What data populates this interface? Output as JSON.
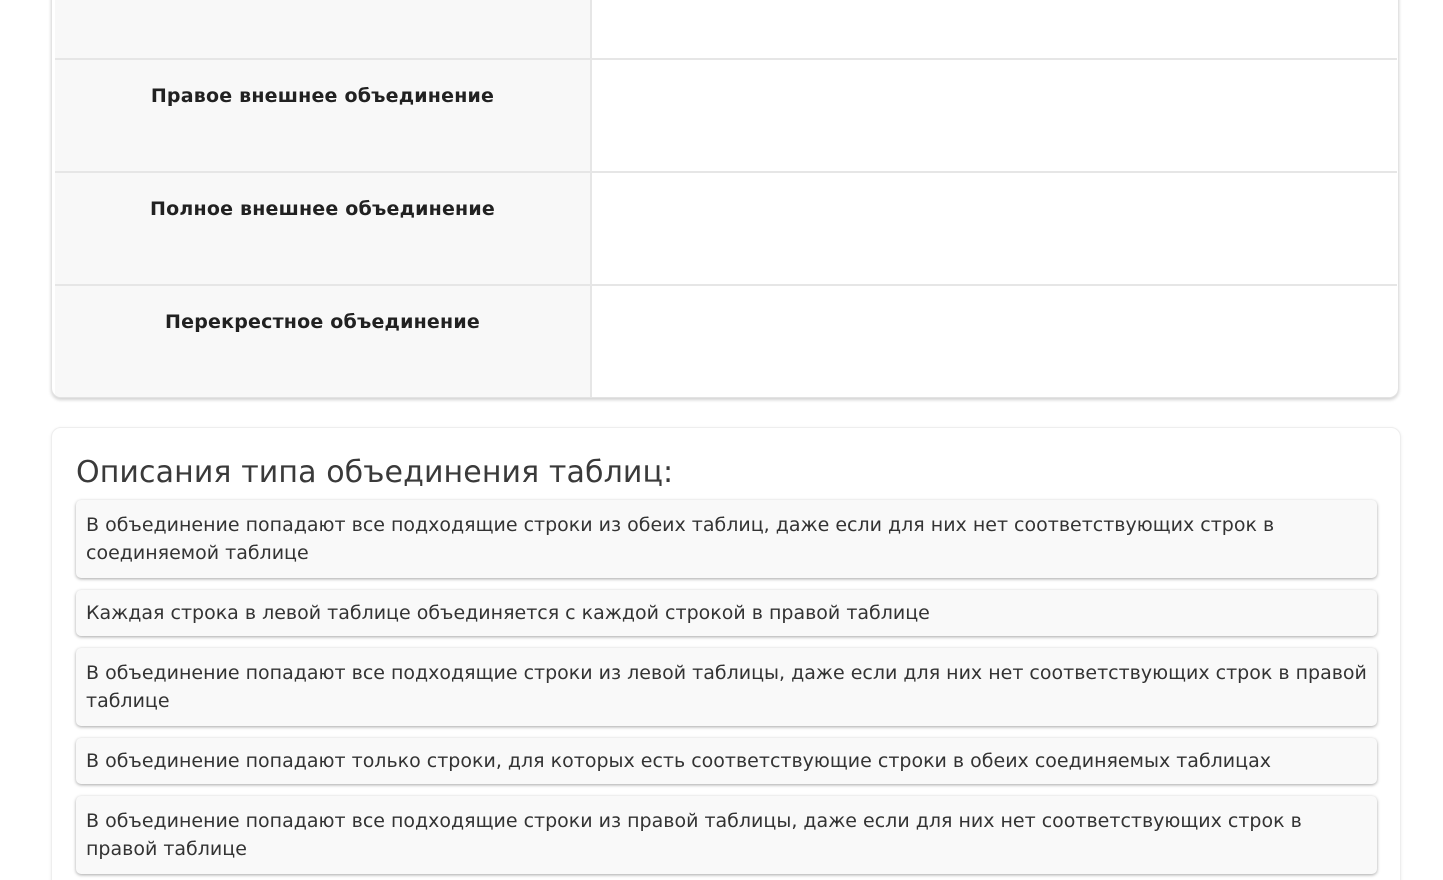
{
  "join_table": {
    "rows": [
      {
        "label": ""
      },
      {
        "label": "Правое внешнее объединение"
      },
      {
        "label": "Полное внешнее объединение"
      },
      {
        "label": "Перекрестное объединение"
      }
    ]
  },
  "descriptions": {
    "title": "Описания типа объединения таблиц:",
    "items": [
      "В объединение попадают все подходящие строки из обеих таблиц, даже если для них нет соответствующих строк в соединяемой таблице",
      "Каждая строка в левой таблице объединяется с каждой строкой в правой таблице",
      "В объединение попадают все подходящие строки из левой таблицы, даже если для них нет соответствующих строк в правой таблице",
      "В объединение попадают только строки, для которых есть соответствующие строки в обеих соединяемых таблицах",
      "В объединение попадают все подходящие строки из правой таблицы, даже если для них нет соответствующих строк в правой таблице"
    ]
  }
}
